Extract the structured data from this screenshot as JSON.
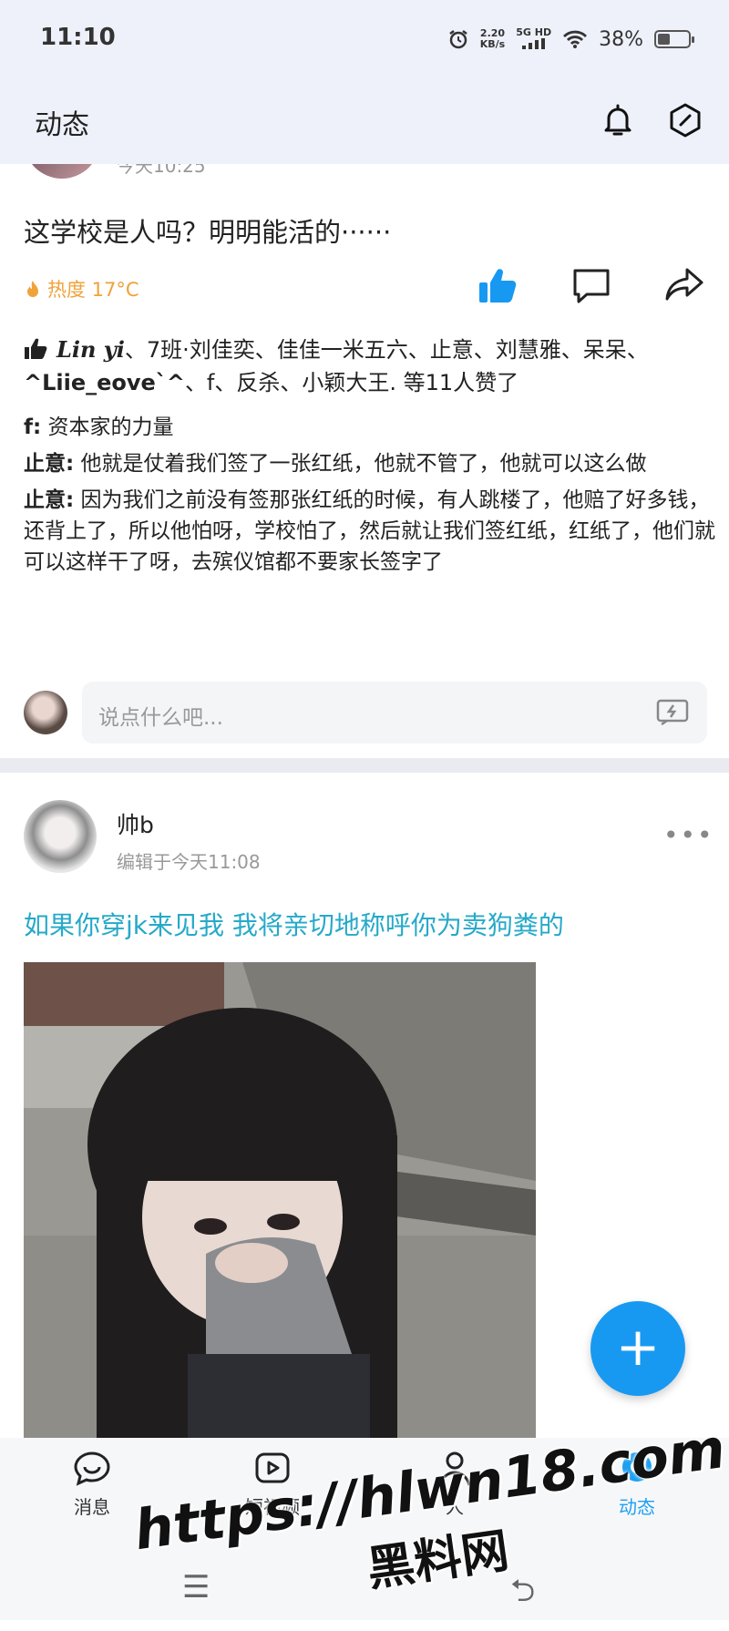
{
  "status_bar": {
    "time": "11:10",
    "net_speed_value": "2.20",
    "net_speed_unit": "KB/s",
    "net_type": "5G HD",
    "battery": "38%"
  },
  "header": {
    "title": "动态"
  },
  "post1": {
    "text": "这学校是人吗？明明能活的······",
    "heat": "热度 17°C",
    "likes_first_user": "Lin yi",
    "likes_rest_a": "、7班·刘佳奕、佳佳一米五六、止意、刘慧雅、呆呆、",
    "likes_bold_user": "^Liie_eove`^",
    "likes_rest_b": "、f、反杀、小颖大王. 等11人赞了",
    "comments": [
      {
        "author": "f:",
        "text": " 资本家的力量"
      },
      {
        "author": "止意:",
        "text": " 他就是仗着我们签了一张红纸，他就不管了，他就可以这么做"
      },
      {
        "author": "止意:",
        "text": " 因为我们之前没有签那张红纸的时候，有人跳楼了，他赔了好多钱，还背上了，所以他怕呀，学校怕了，然后就让我们签红纸，红纸了，他们就可以这样干了呀，去殡仪馆都不要家长签字了"
      }
    ],
    "reply_placeholder": "说点什么吧..."
  },
  "post2": {
    "author": "帅b",
    "time": "编辑于今天11:08",
    "more": "•••",
    "text": "如果你穿jk来见我 我将亲切地称呼你为卖狗粪的"
  },
  "fab_label": "+",
  "tabs": [
    {
      "label": "消息"
    },
    {
      "label": "短视频"
    },
    {
      "label": "人"
    },
    {
      "label": "动态"
    }
  ],
  "watermark": {
    "line1": "https://hlwn18.com",
    "line2": "黑料网"
  },
  "colors": {
    "accent": "#1799f2",
    "link_text": "#26a9c9",
    "heat": "#f0a23a"
  }
}
